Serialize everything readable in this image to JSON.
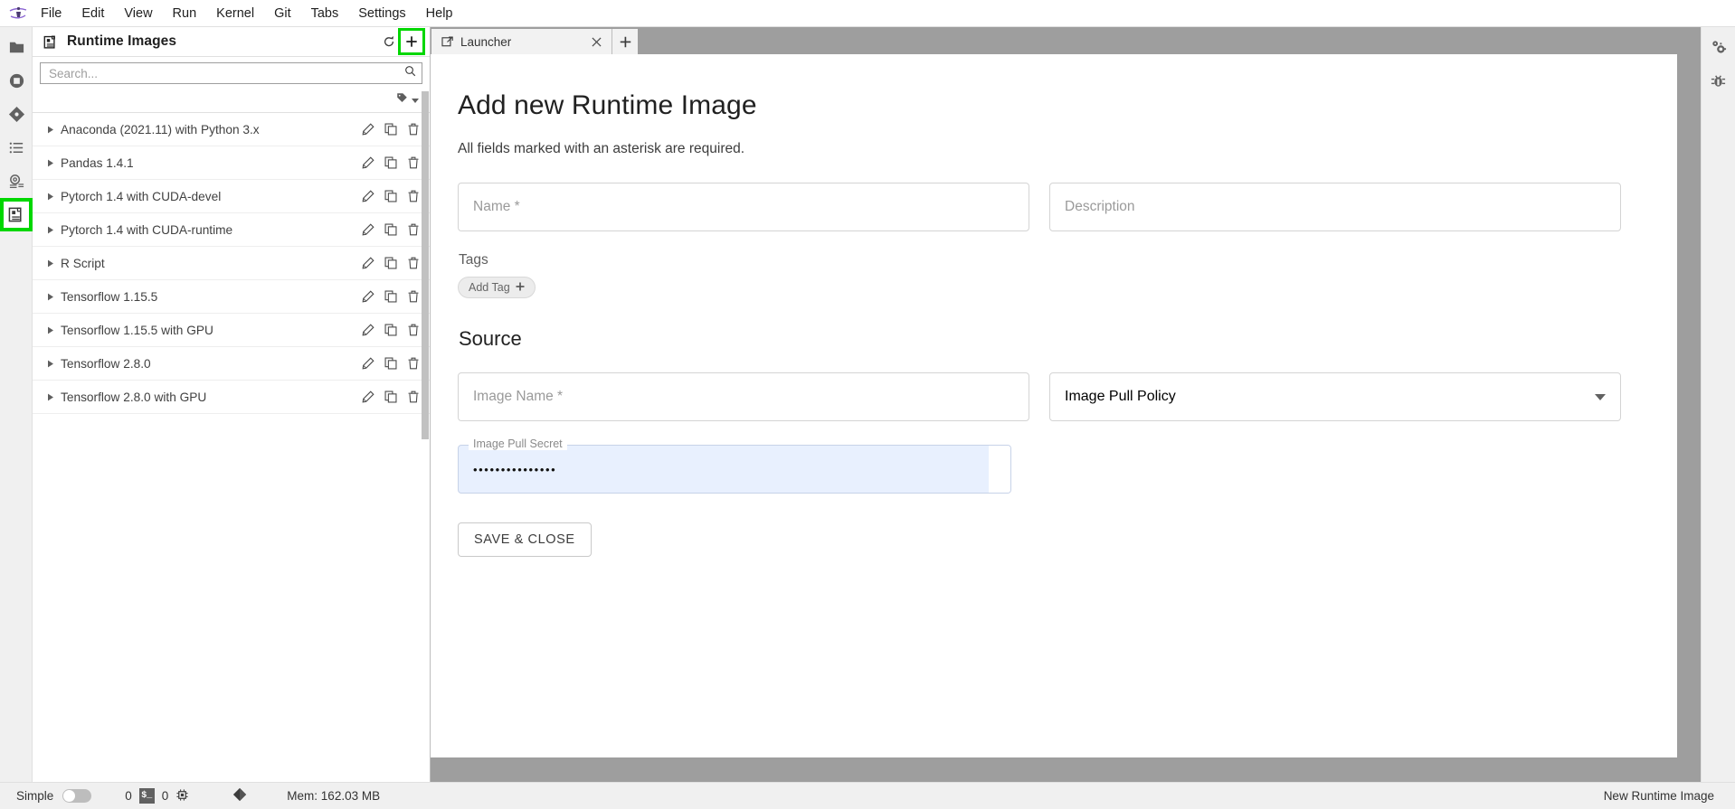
{
  "menubar": {
    "logo_icon": "jupyter-logo-icon",
    "items": [
      {
        "label": "File"
      },
      {
        "label": "Edit"
      },
      {
        "label": "View"
      },
      {
        "label": "Run"
      },
      {
        "label": "Kernel"
      },
      {
        "label": "Git"
      },
      {
        "label": "Tabs"
      },
      {
        "label": "Settings"
      },
      {
        "label": "Help"
      }
    ]
  },
  "activitybar": {
    "items": [
      {
        "name": "file-browser-icon",
        "selected": false,
        "highlighted": false
      },
      {
        "name": "running-terminals-icon",
        "selected": false,
        "highlighted": false
      },
      {
        "name": "git-icon",
        "selected": false,
        "highlighted": false
      },
      {
        "name": "table-of-contents-icon",
        "selected": false,
        "highlighted": false
      },
      {
        "name": "extension-manager-icon",
        "selected": false,
        "highlighted": false
      },
      {
        "name": "runtime-images-icon",
        "selected": true,
        "highlighted": true
      }
    ]
  },
  "leftpanel": {
    "title": "Runtime Images",
    "title_icon": "runtime-images-icon",
    "refresh_icon": "refresh-icon",
    "add_icon": "plus-icon",
    "add_highlighted": true,
    "search": {
      "placeholder": "Search...",
      "value": "",
      "icon": "search-icon"
    },
    "tag_filter": {
      "icon": "tag-icon",
      "chevron": "chevron-down-icon"
    },
    "row_action_icons": {
      "edit": "pencil-icon",
      "duplicate": "copy-icon",
      "delete": "trash-icon"
    },
    "images": [
      {
        "name": "Anaconda (2021.11) with Python 3.x"
      },
      {
        "name": "Pandas 1.4.1"
      },
      {
        "name": "Pytorch 1.4 with CUDA-devel"
      },
      {
        "name": "Pytorch 1.4 with CUDA-runtime"
      },
      {
        "name": "R Script"
      },
      {
        "name": "Tensorflow 1.15.5"
      },
      {
        "name": "Tensorflow 1.15.5 with GPU"
      },
      {
        "name": "Tensorflow 2.8.0"
      },
      {
        "name": "Tensorflow 2.8.0 with GPU"
      }
    ]
  },
  "tabbar": {
    "tabs": [
      {
        "label": "Launcher",
        "icon": "launcher-icon",
        "close_icon": "close-icon",
        "active": true
      }
    ],
    "new_tab_icon": "plus-icon"
  },
  "form": {
    "title": "Add new Runtime Image",
    "subtitle": "All fields marked with an asterisk are required.",
    "name_field": {
      "placeholder": "Name *",
      "value": ""
    },
    "description_field": {
      "placeholder": "Description",
      "value": ""
    },
    "tags_label": "Tags",
    "add_tag_button": "Add Tag",
    "add_tag_icon": "plus-icon",
    "source_section_title": "Source",
    "image_name_field": {
      "placeholder": "Image Name *",
      "value": ""
    },
    "image_pull_policy_field": {
      "placeholder": "Image Pull Policy",
      "value": "",
      "chevron": "chevron-down-icon"
    },
    "image_pull_secret_field": {
      "label": "Image Pull Secret",
      "value": "•••••••••••••••",
      "autofilled": true
    },
    "save_button": "SAVE & CLOSE"
  },
  "rightbar": {
    "items": [
      {
        "name": "property-inspector-icon"
      },
      {
        "name": "debugger-icon"
      }
    ]
  },
  "statusbar": {
    "simple_label": "Simple",
    "simple_toggle_on": false,
    "terminals_count": "0",
    "terminal_icon": "terminal-icon",
    "kernels_count": "0",
    "kernel_icon": "kernel-icon",
    "git_icon": "git-icon",
    "memory": "Mem: 162.03 MB",
    "right_label": "New Runtime Image"
  },
  "colors": {
    "highlight_green": "#00d700",
    "autofill_blue": "#e8f0fe",
    "panel_border": "#bdbdbd",
    "chrome_gray": "#9e9e9e"
  }
}
